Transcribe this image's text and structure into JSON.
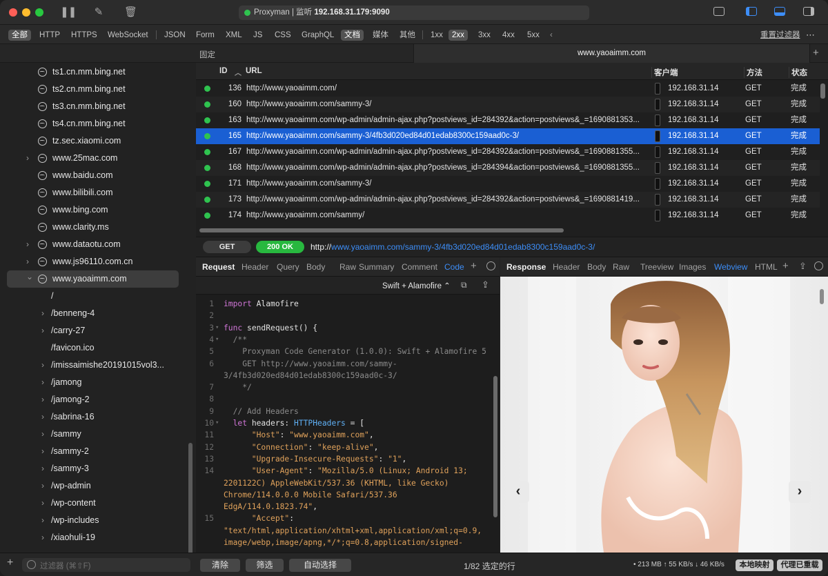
{
  "titlebar": {
    "app": "Proxyman | 监听",
    "address": "192.168.31.179:9090"
  },
  "filters": {
    "items": [
      "全部",
      "HTTP",
      "HTTPS",
      "WebSocket",
      "JSON",
      "Form",
      "XML",
      "JS",
      "CSS",
      "GraphQL",
      "文档",
      "媒体",
      "其他",
      "1xx",
      "2xx",
      "3xx",
      "4xx",
      "5xx"
    ],
    "selected": [
      "全部",
      "文档",
      "2xx"
    ],
    "reset": "重置过滤器"
  },
  "tabs": {
    "pinned": "固定",
    "active": "www.yaoaimm.com"
  },
  "sidebar": {
    "items": [
      {
        "label": "ts1.cn.mm.bing.net",
        "expandable": false
      },
      {
        "label": "ts2.cn.mm.bing.net",
        "expandable": false
      },
      {
        "label": "ts3.cn.mm.bing.net",
        "expandable": false
      },
      {
        "label": "ts4.cn.mm.bing.net",
        "expandable": false
      },
      {
        "label": "tz.sec.xiaomi.com",
        "expandable": false
      },
      {
        "label": "www.25mac.com",
        "expandable": true
      },
      {
        "label": "www.baidu.com",
        "expandable": false
      },
      {
        "label": "www.bilibili.com",
        "expandable": false
      },
      {
        "label": "www.bing.com",
        "expandable": false
      },
      {
        "label": "www.clarity.ms",
        "expandable": false
      },
      {
        "label": "www.dataotu.com",
        "expandable": true
      },
      {
        "label": "www.js96110.com.cn",
        "expandable": true
      },
      {
        "label": "www.yaoaimm.com",
        "expandable": true,
        "expanded": true
      }
    ],
    "children": [
      {
        "label": "/",
        "expandable": false
      },
      {
        "label": "/benneng-4",
        "expandable": true
      },
      {
        "label": "/carry-27",
        "expandable": true
      },
      {
        "label": "/favicon.ico",
        "expandable": false
      },
      {
        "label": "/imissaimishe20191015vol3...",
        "expandable": true
      },
      {
        "label": "/jamong",
        "expandable": true
      },
      {
        "label": "/jamong-2",
        "expandable": true
      },
      {
        "label": "/sabrina-16",
        "expandable": true
      },
      {
        "label": "/sammy",
        "expandable": true
      },
      {
        "label": "/sammy-2",
        "expandable": true
      },
      {
        "label": "/sammy-3",
        "expandable": true
      },
      {
        "label": "/wp-admin",
        "expandable": true
      },
      {
        "label": "/wp-content",
        "expandable": true
      },
      {
        "label": "/wp-includes",
        "expandable": true
      },
      {
        "label": "/xiaohuli-19",
        "expandable": true
      }
    ],
    "filter_placeholder": "过滤器 (⌘⇧F)"
  },
  "table": {
    "headers": {
      "id": "ID",
      "url": "URL",
      "client": "客户端",
      "method": "方法",
      "status": "状态"
    },
    "rows": [
      {
        "id": "136",
        "url": "http://www.yaoaimm.com/",
        "client": "192.168.31.14",
        "method": "GET",
        "status": "完成"
      },
      {
        "id": "160",
        "url": "http://www.yaoaimm.com/sammy-3/",
        "client": "192.168.31.14",
        "method": "GET",
        "status": "完成"
      },
      {
        "id": "163",
        "url": "http://www.yaoaimm.com/wp-admin/admin-ajax.php?postviews_id=284392&action=postviews&_=1690881353...",
        "client": "192.168.31.14",
        "method": "GET",
        "status": "完成"
      },
      {
        "id": "165",
        "url": "http://www.yaoaimm.com/sammy-3/4fb3d020ed84d01edab8300c159aad0c-3/",
        "client": "192.168.31.14",
        "method": "GET",
        "status": "完成",
        "selected": true
      },
      {
        "id": "167",
        "url": "http://www.yaoaimm.com/wp-admin/admin-ajax.php?postviews_id=284392&action=postviews&_=1690881355...",
        "client": "192.168.31.14",
        "method": "GET",
        "status": "完成"
      },
      {
        "id": "168",
        "url": "http://www.yaoaimm.com/wp-admin/admin-ajax.php?postviews_id=284394&action=postviews&_=1690881355...",
        "client": "192.168.31.14",
        "method": "GET",
        "status": "完成"
      },
      {
        "id": "171",
        "url": "http://www.yaoaimm.com/sammy-3/",
        "client": "192.168.31.14",
        "method": "GET",
        "status": "完成"
      },
      {
        "id": "173",
        "url": "http://www.yaoaimm.com/wp-admin/admin-ajax.php?postviews_id=284392&action=postviews&_=1690881419...",
        "client": "192.168.31.14",
        "method": "GET",
        "status": "完成"
      },
      {
        "id": "174",
        "url": "http://www.yaoaimm.com/sammy/",
        "client": "192.168.31.14",
        "method": "GET",
        "status": "完成"
      }
    ]
  },
  "request_line": {
    "method": "GET",
    "status": "200 OK",
    "url_prefix": "http://",
    "url_host": "www.yaoaimm.com",
    "url_path": "/sammy-3/4fb3d020ed84d01edab8300c159aad0c-3/"
  },
  "request_panel": {
    "title": "Request",
    "tabs": [
      "Header",
      "Query",
      "Body",
      "Raw",
      "Summary",
      "Comment",
      "Code"
    ],
    "active_tab": "Code",
    "generator": "Swift + Alamofire ⌃"
  },
  "response_panel": {
    "title": "Response",
    "tabs": [
      "Header",
      "Body",
      "Raw",
      "Treeview",
      "Images",
      "Webview",
      "HTML"
    ],
    "active_tab": "Webview"
  },
  "code": [
    {
      "n": "1",
      "segs": [
        [
          "kw",
          "import"
        ],
        [
          "pl",
          " Alamofire"
        ]
      ],
      "hl": true
    },
    {
      "n": "2",
      "segs": []
    },
    {
      "n": "3",
      "fold": true,
      "segs": [
        [
          "kw",
          "func"
        ],
        [
          "pl",
          " sendRequest() {"
        ]
      ]
    },
    {
      "n": "4",
      "fold": true,
      "segs": [
        [
          "cm",
          "  /**"
        ]
      ]
    },
    {
      "n": "5",
      "segs": [
        [
          "cm",
          "    Proxyman Code Generator (1.0.0): Swift + Alamofire 5"
        ]
      ]
    },
    {
      "n": "6",
      "segs": [
        [
          "cm",
          "    GET http://www.yaoaimm.com/sammy-"
        ]
      ]
    },
    {
      "n": "",
      "segs": [
        [
          "cm",
          "3/4fb3d020ed84d01edab8300c159aad0c-3/"
        ]
      ]
    },
    {
      "n": "7",
      "segs": [
        [
          "cm",
          "    */"
        ]
      ]
    },
    {
      "n": "8",
      "segs": []
    },
    {
      "n": "9",
      "segs": [
        [
          "cm",
          "  // Add Headers"
        ]
      ]
    },
    {
      "n": "10",
      "fold": true,
      "segs": [
        [
          "kw",
          "  let"
        ],
        [
          "pl",
          " headers: "
        ],
        [
          "ty",
          "HTTPHeaders"
        ],
        [
          "pl",
          " = ["
        ]
      ]
    },
    {
      "n": "11",
      "segs": [
        [
          "str",
          "      \"Host\""
        ],
        [
          "pl",
          ": "
        ],
        [
          "str",
          "\"www.yaoaimm.com\""
        ],
        [
          "pl",
          ","
        ]
      ]
    },
    {
      "n": "12",
      "segs": [
        [
          "str",
          "      \"Connection\""
        ],
        [
          "pl",
          ": "
        ],
        [
          "str",
          "\"keep-alive\""
        ],
        [
          "pl",
          ","
        ]
      ]
    },
    {
      "n": "13",
      "segs": [
        [
          "str",
          "      \"Upgrade-Insecure-Requests\""
        ],
        [
          "pl",
          ": "
        ],
        [
          "str",
          "\"1\""
        ],
        [
          "pl",
          ","
        ]
      ]
    },
    {
      "n": "14",
      "segs": [
        [
          "str",
          "      \"User-Agent\""
        ],
        [
          "pl",
          ": "
        ],
        [
          "str",
          "\"Mozilla/5.0 (Linux; Android 13;"
        ]
      ]
    },
    {
      "n": "",
      "segs": [
        [
          "str",
          "2201122C) AppleWebKit/537.36 (KHTML, like Gecko)"
        ]
      ]
    },
    {
      "n": "",
      "segs": [
        [
          "str",
          "Chrome/114.0.0.0 Mobile Safari/537.36"
        ]
      ]
    },
    {
      "n": "",
      "segs": [
        [
          "str",
          "EdgA/114.0.1823.74\""
        ],
        [
          "pl",
          ","
        ]
      ]
    },
    {
      "n": "15",
      "segs": [
        [
          "str",
          "      \"Accept\""
        ],
        [
          "pl",
          ":"
        ]
      ]
    },
    {
      "n": "",
      "segs": [
        [
          "str",
          "\"text/html,application/xhtml+xml,application/xml;q=0.9,"
        ]
      ]
    },
    {
      "n": "",
      "segs": [
        [
          "str",
          "image/webp,image/apng,*/*;q=0.8,application/signed-"
        ]
      ]
    }
  ],
  "bottom": {
    "clear": "清除",
    "filter": "筛选",
    "autoselect": "自动选择",
    "selection": "1/82 选定的行",
    "stats": "• 213 MB ↑ 55 KB/s ↓ 46 KB/s",
    "badge_local": "本地映射",
    "badge_proxy": "代理已重载"
  },
  "colors": {
    "accent": "#1a5fd3",
    "ok_green": "#2fc34f",
    "link_blue": "#3d8ef8"
  }
}
